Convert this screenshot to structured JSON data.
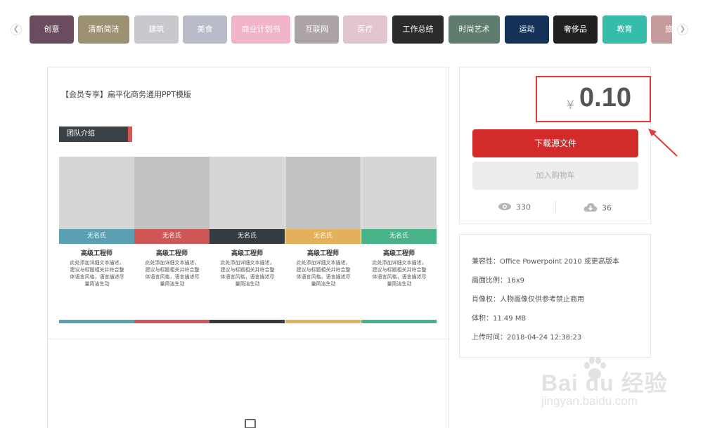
{
  "categories": [
    {
      "label": "创意",
      "color": "#6b4c5e"
    },
    {
      "label": "清新简洁",
      "color": "#9c9273"
    },
    {
      "label": "建筑",
      "color": "#c9c9cd"
    },
    {
      "label": "美食",
      "color": "#b9bcc8"
    },
    {
      "label": "商业计划书",
      "color": "#f1b4c8"
    },
    {
      "label": "互联网",
      "color": "#aba3a5"
    },
    {
      "label": "医疗",
      "color": "#e2c5cc"
    },
    {
      "label": "工作总结",
      "color": "#2b2b2b"
    },
    {
      "label": "时尚艺术",
      "color": "#5f7d6f"
    },
    {
      "label": "运动",
      "color": "#163157"
    },
    {
      "label": "奢侈品",
      "color": "#202020"
    },
    {
      "label": "教育",
      "color": "#36bcaa"
    },
    {
      "label": "旅",
      "color": "#c59b9e"
    }
  ],
  "main": {
    "title": "【会员专享】扁平化商务通用PPT模版",
    "slide": {
      "section_label": "团队介绍",
      "members": [
        {
          "name": "无名氏",
          "role": "高级工程师",
          "desc": "此处添加详细文本描述，建议与标题相关并符合整体语言风格，语言描述尽量简洁生动",
          "color": "#5b9fb3",
          "photo": "#d6d6d6"
        },
        {
          "name": "无名氏",
          "role": "高级工程师",
          "desc": "此处添加详细文本描述，建议与标题相关并符合整体语言风格，语言描述尽量简洁生动",
          "color": "#cf5656",
          "photo": "#c2c2c2"
        },
        {
          "name": "无名氏",
          "role": "高级工程师",
          "desc": "此处添加详细文本描述，建议与标题相关并符合整体语言风格，语言描述尽量简洁生动",
          "color": "#343c41",
          "photo": "#d6d6d6"
        },
        {
          "name": "无名氏",
          "role": "高级工程师",
          "desc": "此处添加详细文本描述，建议与标题相关并符合整体语言风格，语言描述尽量简洁生动",
          "color": "#e4b05a",
          "photo": "#c2c2c2"
        },
        {
          "name": "无名氏",
          "role": "高级工程师",
          "desc": "此处添加详细文本描述，建议与标题相关并符合整体语言风格，语言描述尽量简洁生动",
          "color": "#48b289",
          "photo": "#d6d6d6"
        }
      ]
    }
  },
  "purchase": {
    "currency": "¥",
    "price": "0.10",
    "download_label": "下载源文件",
    "cart_label": "加入购物车",
    "views": "330",
    "downloads": "36"
  },
  "info": {
    "compat": "兼容性：Office Powerpoint 2010 或更高版本",
    "ratio": "画面比例：16x9",
    "portrait": "肖像权：人物画像仅供参考禁止商用",
    "size": "体积：11.49 MB",
    "upload": "上传时间：2018-04-24 12:38:23"
  },
  "watermark": {
    "brand": "Bai du 经验",
    "url": "jingyan.baidu.com"
  },
  "colors": {
    "accent_red": "#d32a2a",
    "annotation_red": "#e03a3a"
  }
}
